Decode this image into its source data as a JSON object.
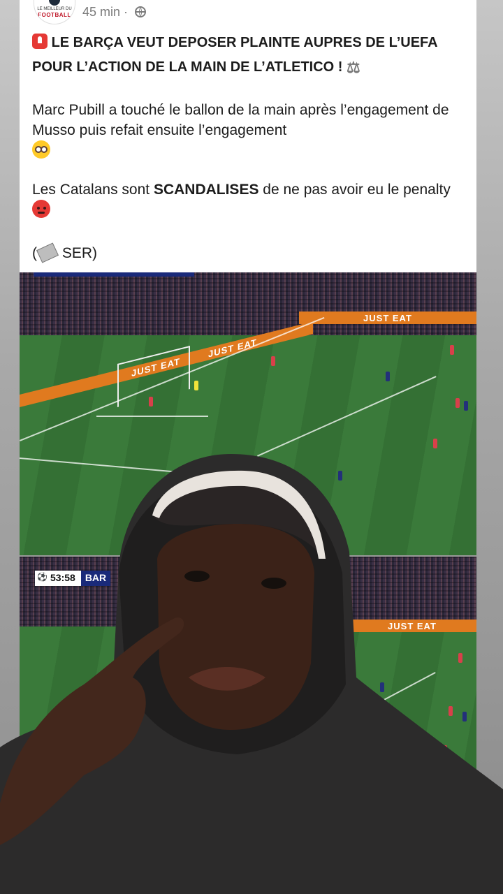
{
  "post": {
    "time": "45 min ·",
    "avatar_line1": "LE MEILLEUR DU",
    "avatar_line2": "FOOTBALL",
    "headline": "LE BARÇA VEUT DEPOSER PLAINTE AUPRES DE L’UEFA POUR L’ACTION DE LA MAIN DE L’ATLETICO !",
    "para1": "Marc Pubill a touché le ballon de la main après l’engagement de Musso puis refait ensuite l’engagement",
    "para2_before": "Les Catalans sont ",
    "para2_bold": "SCANDALISES",
    "para2_after": " de ne pas avoir eu le penalty",
    "para3_open": "(",
    "para3_text": "SER)"
  },
  "screenshot1": {
    "board_left": "JUST EAT",
    "board_mid": "JUST EAT",
    "board_right": "JUST EAT",
    "board_right2": "JUST EAT"
  },
  "screenshot2": {
    "clock": "53:58",
    "team": "BAR",
    "board": "JUST EAT"
  },
  "icons": [
    "siren-icon",
    "scale-icon",
    "flushed-face-icon",
    "angry-face-icon",
    "newspaper-icon",
    "globe-icon",
    "uefa-logo-icon"
  ],
  "colors": {
    "board": "#e07a1f",
    "pitch": "#3a7a3a",
    "score_team": "#1a2a7a"
  }
}
